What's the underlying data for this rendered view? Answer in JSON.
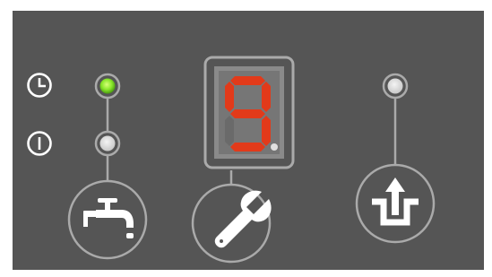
{
  "panel": {
    "background": "#555555",
    "line_color": "#aaaaaa",
    "icon_color": "#ffffff"
  },
  "indicators": {
    "timer_mode_icon": "clock-icon",
    "power_mode_icon": "power-icon",
    "timer_led": {
      "state": "on",
      "color": "#8be82c"
    },
    "power_led": {
      "state": "off",
      "color": "#e0e0e0"
    },
    "drain_led": {
      "state": "off",
      "color": "#e0e0e0"
    }
  },
  "display": {
    "digit": "9",
    "segment_on_color": "#e23a1a",
    "segment_off_color": "#6a6a6a",
    "decimal_point": "off"
  },
  "buttons": {
    "water": {
      "icon": "faucet-icon"
    },
    "service": {
      "icon": "wrench-icon"
    },
    "drain": {
      "icon": "upload-tray-icon"
    }
  }
}
